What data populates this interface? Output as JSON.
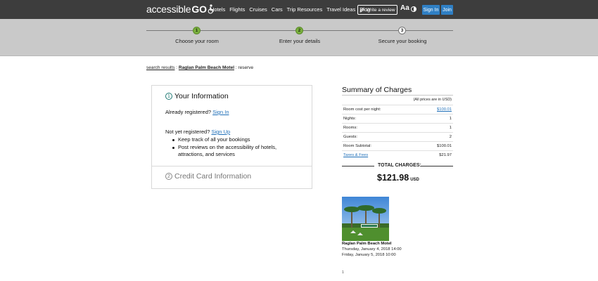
{
  "header": {
    "logo_text": "accessible",
    "logo_go": "GO",
    "nav": [
      "Hotels",
      "Flights",
      "Cruises",
      "Cars",
      "Trip Resources",
      "Travel Ideas",
      "Blog"
    ],
    "write_review": "Write a review",
    "text_size": "Aa",
    "sign_in": "Sign In",
    "join": "Join"
  },
  "steps": [
    {
      "num": "1",
      "label": "Choose your room",
      "state": "done"
    },
    {
      "num": "2",
      "label": "Enter your details",
      "state": "done"
    },
    {
      "num": "3",
      "label": "Secure your booking",
      "state": "current"
    }
  ],
  "breadcrumb": {
    "search": "search results",
    "sep1": " : ",
    "hotel": "Raglan Palm Beach Motel",
    "sep2": " : ",
    "current": "reserve"
  },
  "info": {
    "section1_num": "1",
    "section1_title": "Your Information",
    "registered_q": "Already registered?",
    "sign_in_link": "Sign In",
    "not_registered_q": "Not yet registered?",
    "sign_up_link": "Sign Up",
    "benefits": [
      "Keep track of all your bookings",
      "Post reviews on the accessibility of hotels, attractions, and services"
    ],
    "section2_num": "2",
    "section2_title": "Credit Card Information"
  },
  "summary": {
    "title": "Summary of Charges",
    "note": "(All prices are in USD)",
    "rows": [
      {
        "label": "Room cost per night:",
        "value": "$100.01"
      },
      {
        "label": "Nights:",
        "value": "1"
      },
      {
        "label": "Rooms:",
        "value": "1"
      },
      {
        "label": "Guests:",
        "value": "2"
      },
      {
        "label": "Room Subtotal:",
        "value": "$100.01"
      },
      {
        "label": "Taxes & Fees",
        "value": "$21.97"
      }
    ],
    "total_label": "TOTAL CHARGES:",
    "total_value": "$121.98",
    "total_currency": "USD"
  },
  "hotel": {
    "name": "Raglan Palm Beach Motel",
    "check_in": "Thursday, January 4, 2018 14:00",
    "check_out": "Friday, January 5, 2018 10:00",
    "footnote1": "1"
  },
  "colors": {
    "topbar": "#3d3d3d",
    "progress_band": "#c9c9c9",
    "step_done": "#7ab03e",
    "link": "#1f6fb8",
    "button_blue": "#2f7fc4"
  }
}
